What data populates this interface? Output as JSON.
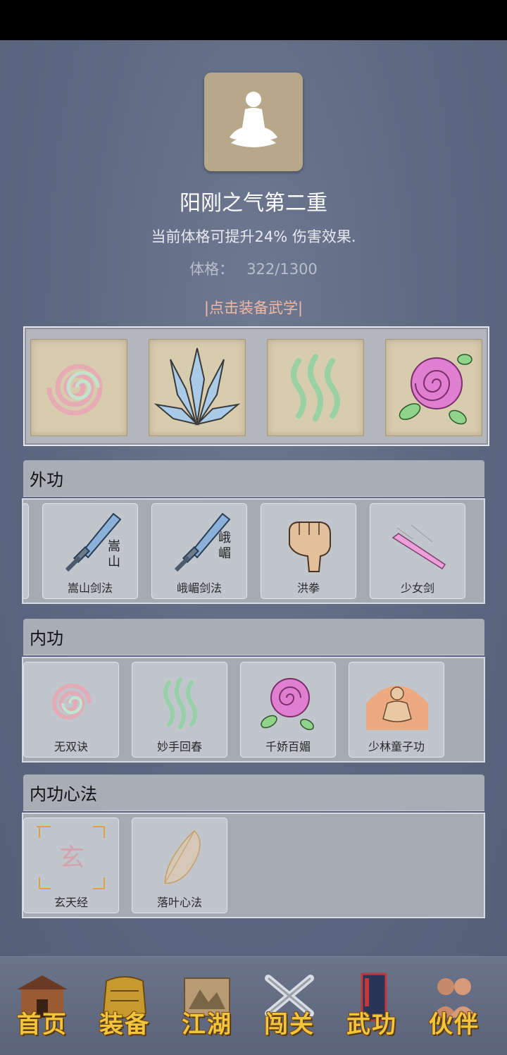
{
  "skill": {
    "name": "阳刚之气第二重",
    "effect": "当前体格可提升24% 伤害效果.",
    "stat_label": "体格：",
    "stat_value": "322/1300",
    "equip_link": "|点击装备武学|"
  },
  "equipped_slots": [
    {
      "icon": "spiral-icon"
    },
    {
      "icon": "crystal-blades-icon"
    },
    {
      "icon": "green-wisps-icon"
    },
    {
      "icon": "rose-icon"
    }
  ],
  "sections": {
    "waigong": {
      "title": "外功",
      "items": [
        {
          "label": "嵩山剑法",
          "icon": "sword-icon",
          "glyph": "嵩\n山"
        },
        {
          "label": "峨嵋剑法",
          "icon": "sword-icon",
          "glyph": "峨\n嵋"
        },
        {
          "label": "洪拳",
          "icon": "fist-icon"
        },
        {
          "label": "少女剑",
          "icon": "pink-sword-icon"
        }
      ]
    },
    "neigong": {
      "title": "内功",
      "items": [
        {
          "label": "无双诀",
          "icon": "spiral-icon"
        },
        {
          "label": "妙手回春",
          "icon": "green-wisps-icon"
        },
        {
          "label": "千娇百媚",
          "icon": "rose-icon"
        },
        {
          "label": "少林童子功",
          "icon": "meditating-monk-icon"
        }
      ]
    },
    "xinfa": {
      "title": "内功心法",
      "items": [
        {
          "label": "玄天经",
          "icon": "xuan-icon",
          "glyph": "玄"
        },
        {
          "label": "落叶心法",
          "icon": "leaf-icon"
        }
      ]
    }
  },
  "nav": [
    {
      "label": "首页",
      "icon": "house-icon"
    },
    {
      "label": "装备",
      "icon": "armor-icon"
    },
    {
      "label": "江湖",
      "icon": "scroll-map-icon"
    },
    {
      "label": "闯关",
      "icon": "crossed-swords-icon"
    },
    {
      "label": "武功",
      "icon": "book-icon"
    },
    {
      "label": "伙伴",
      "icon": "companions-icon"
    }
  ],
  "colors": {
    "background": "#5f6a82",
    "accent_link": "#f0b9a6",
    "nav_text": "#f2c53a"
  }
}
